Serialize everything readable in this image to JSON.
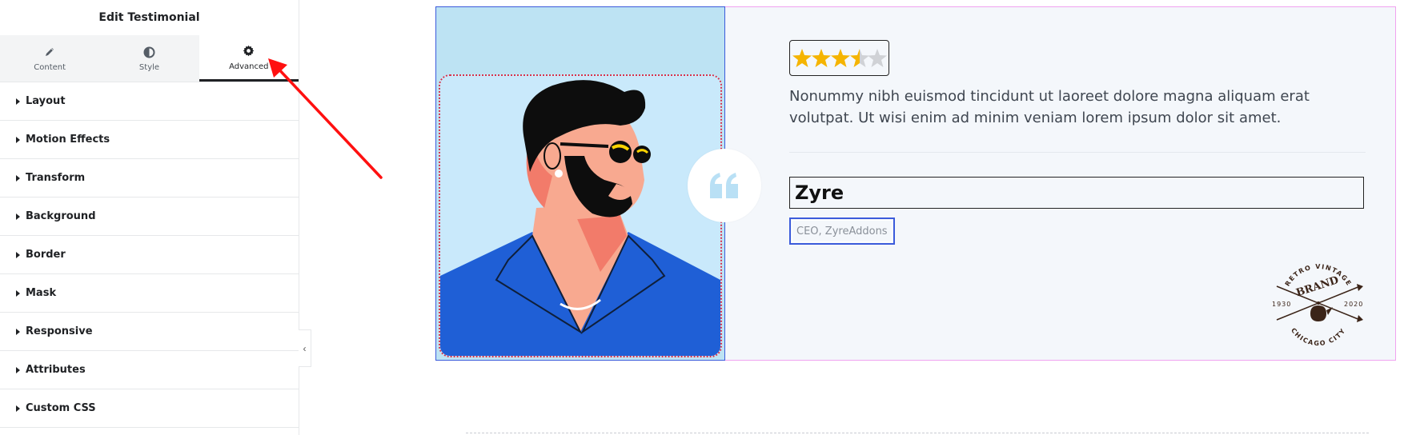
{
  "panel": {
    "title": "Edit Testimonial",
    "tabs": [
      {
        "label": "Content",
        "icon": "pencil-icon"
      },
      {
        "label": "Style",
        "icon": "half-circle-icon"
      },
      {
        "label": "Advanced",
        "icon": "gear-icon",
        "active": true
      }
    ],
    "sections": [
      "Layout",
      "Motion Effects",
      "Transform",
      "Background",
      "Border",
      "Mask",
      "Responsive",
      "Attributes",
      "Custom CSS"
    ],
    "collapse_icon": "chevron-left-icon"
  },
  "annotation": {
    "color": "#ff1010",
    "icon": "arrow-icon"
  },
  "testimonial": {
    "rating": 3.5,
    "rating_max": 5,
    "description": "Nonummy nibh euismod tincidunt ut laoreet dolore magna aliquam erat volutpat. Ut wisi enim ad minim veniam lorem ipsum dolor sit amet.",
    "name": "Zyre",
    "title": "CEO, ZyreAddons",
    "quote_icon": "quote-icon",
    "logo": {
      "top": "RETRO VINTAGE",
      "center": "BRAND",
      "left_year": "1930",
      "right_year": "2020",
      "bottom": "CHICAGO CITY"
    },
    "colors": {
      "star": "#f5b400",
      "accent_border": "#3b5bdb",
      "quote": "#b9e0f5",
      "card_border": "#f0a3f0"
    }
  }
}
